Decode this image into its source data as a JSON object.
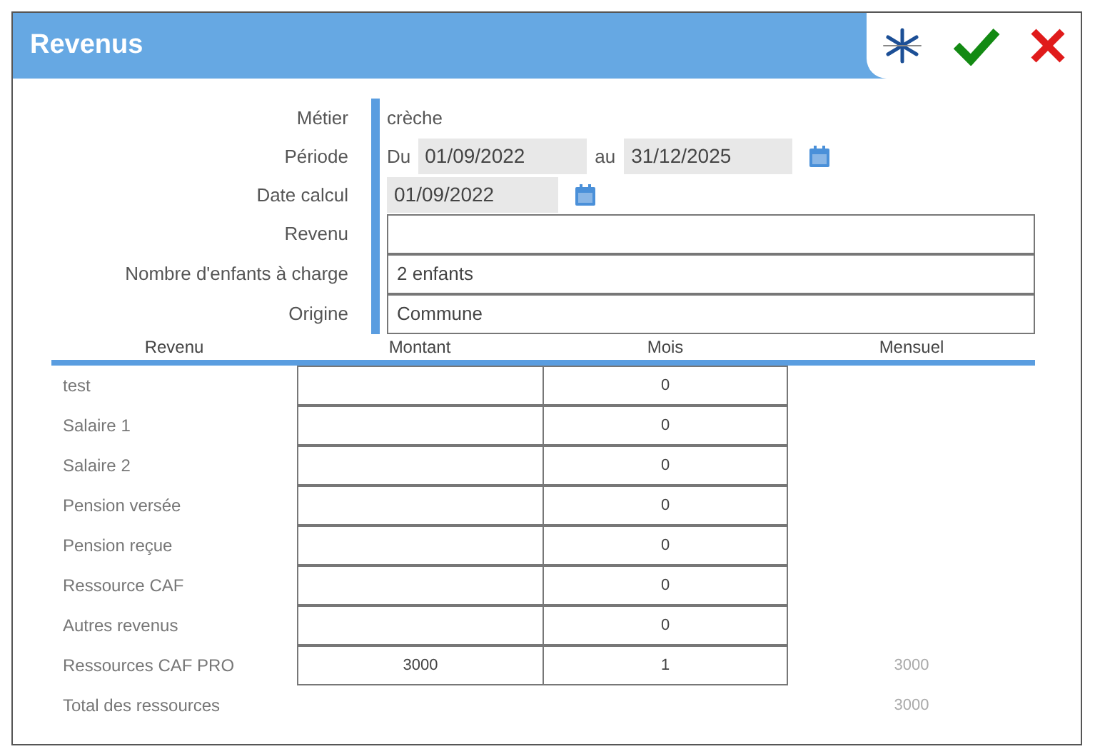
{
  "window": {
    "title": "Revenus"
  },
  "form": [
    {
      "label": "Métier",
      "kind": "text",
      "value": "crèche"
    },
    {
      "label": "Période",
      "kind": "period",
      "from_label": "Du",
      "from": "01/09/2022",
      "to_label": "au",
      "to": "31/12/2025"
    },
    {
      "label": "Date calcul",
      "kind": "date",
      "value": "01/09/2022"
    },
    {
      "label": "Revenu",
      "kind": "input"
    },
    {
      "label": "Nombre d'enfants à charge",
      "kind": "input",
      "value": "2 enfants"
    },
    {
      "label": "Origine",
      "kind": "input",
      "value": "Commune"
    }
  ],
  "table": {
    "columns": [
      "Revenu",
      "Montant",
      "Mois",
      "Mensuel"
    ],
    "rows": [
      {
        "kind": "entry",
        "label": "test",
        "mois": "0"
      },
      {
        "kind": "entry",
        "label": "Salaire 1",
        "mois": "0"
      },
      {
        "kind": "entry",
        "label": "Salaire 2",
        "mois": "0"
      },
      {
        "kind": "entry",
        "label": "Pension versée",
        "mois": "0"
      },
      {
        "kind": "entry",
        "label": "Pension reçue",
        "mois": "0"
      },
      {
        "kind": "entry",
        "label": "Ressource CAF",
        "mois": "0"
      },
      {
        "kind": "entry",
        "label": "Autres revenus",
        "mois": "0"
      },
      {
        "kind": "entry",
        "label": "Ressources CAF PRO",
        "montant": "3000",
        "mois": "1",
        "mensuel": "3000"
      },
      {
        "kind": "total",
        "label": "Total des ressources",
        "mensuel": "3000"
      }
    ]
  }
}
